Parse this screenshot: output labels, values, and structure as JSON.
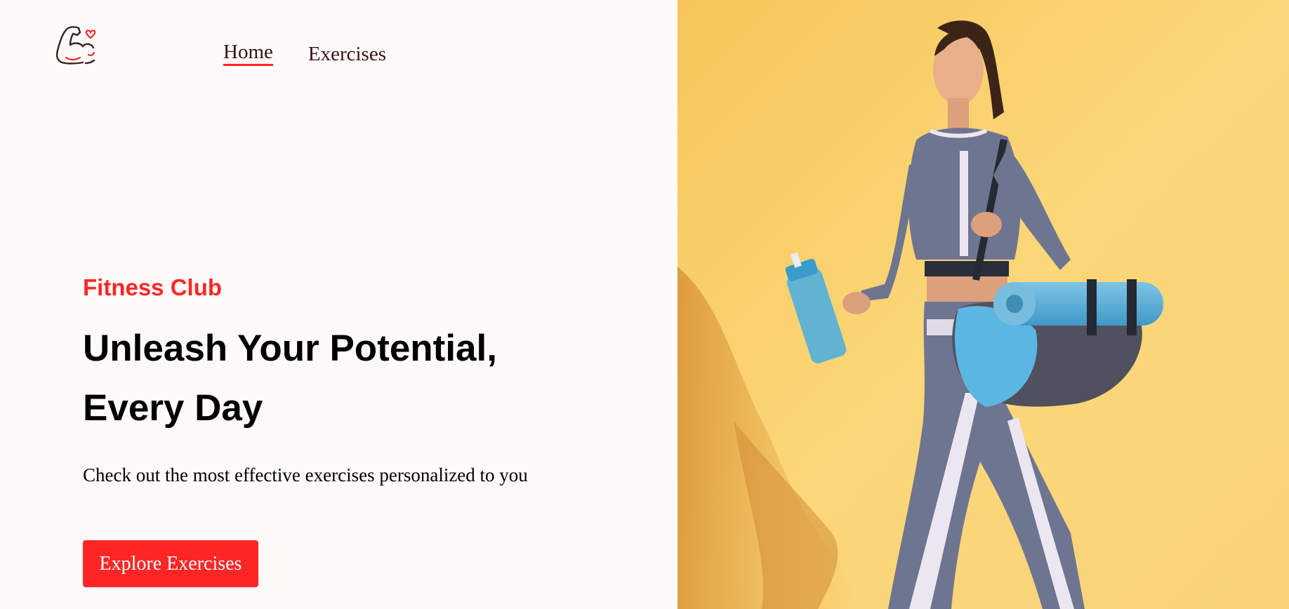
{
  "header": {
    "logo_icon": "flexed-arm-heart-icon",
    "nav": [
      {
        "label": "Home",
        "active": true
      },
      {
        "label": "Exercises",
        "active": false
      }
    ]
  },
  "hero": {
    "eyebrow": "Fitness Club",
    "title": "Unleash Your Potential, Every Day",
    "subtitle": "Check out the most effective exercises personalized to you",
    "cta_label": "Explore Exercises"
  },
  "banner": {
    "image": "woman-walking-with-shaker-and-yoga-mat-photo"
  },
  "colors": {
    "accent": "#ff2625",
    "page_background": "#fffafa",
    "banner_background": "#fbd36b",
    "nav_text": "#3a1212"
  }
}
